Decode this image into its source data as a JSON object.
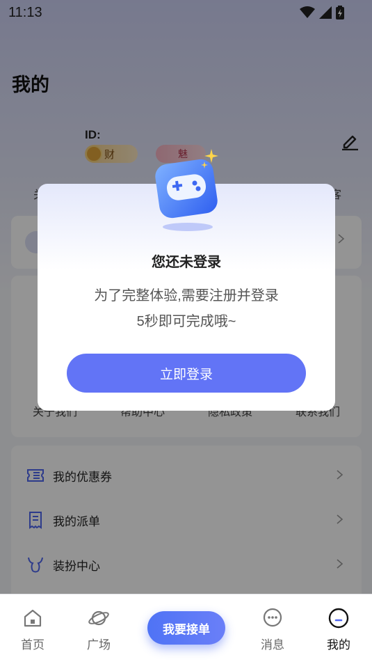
{
  "status_bar": {
    "time": "11:13"
  },
  "page": {
    "title": "我的"
  },
  "profile": {
    "id_label": "ID:",
    "wealth_label": "财",
    "charm_label": "魅",
    "stats_left": "关",
    "stats_right": "客"
  },
  "services": [
    "关于我们",
    "帮助中心",
    "隐私政策",
    "联系我们"
  ],
  "menu": {
    "items": [
      {
        "label": "我的优惠券",
        "icon": "coupon-icon"
      },
      {
        "label": "我的派单",
        "icon": "order-list-icon"
      },
      {
        "label": "装扮中心",
        "icon": "dress-up-icon"
      }
    ]
  },
  "modal": {
    "title": "您还未登录",
    "line1": "为了完整体验,需要注册并登录",
    "line2": "5秒即可完成哦~",
    "button": "立即登录",
    "icon": "gamepad-icon"
  },
  "bottom_nav": {
    "items": [
      {
        "label": "首页",
        "icon": "home-icon"
      },
      {
        "label": "广场",
        "icon": "planet-icon"
      },
      {
        "label": "消息",
        "icon": "message-icon"
      },
      {
        "label": "我的",
        "icon": "profile-icon"
      }
    ],
    "center_button": "我要接单",
    "active_index": 3
  },
  "colors": {
    "accent": "#6274f6",
    "overlay": "rgba(0,0,0,0.42)"
  }
}
